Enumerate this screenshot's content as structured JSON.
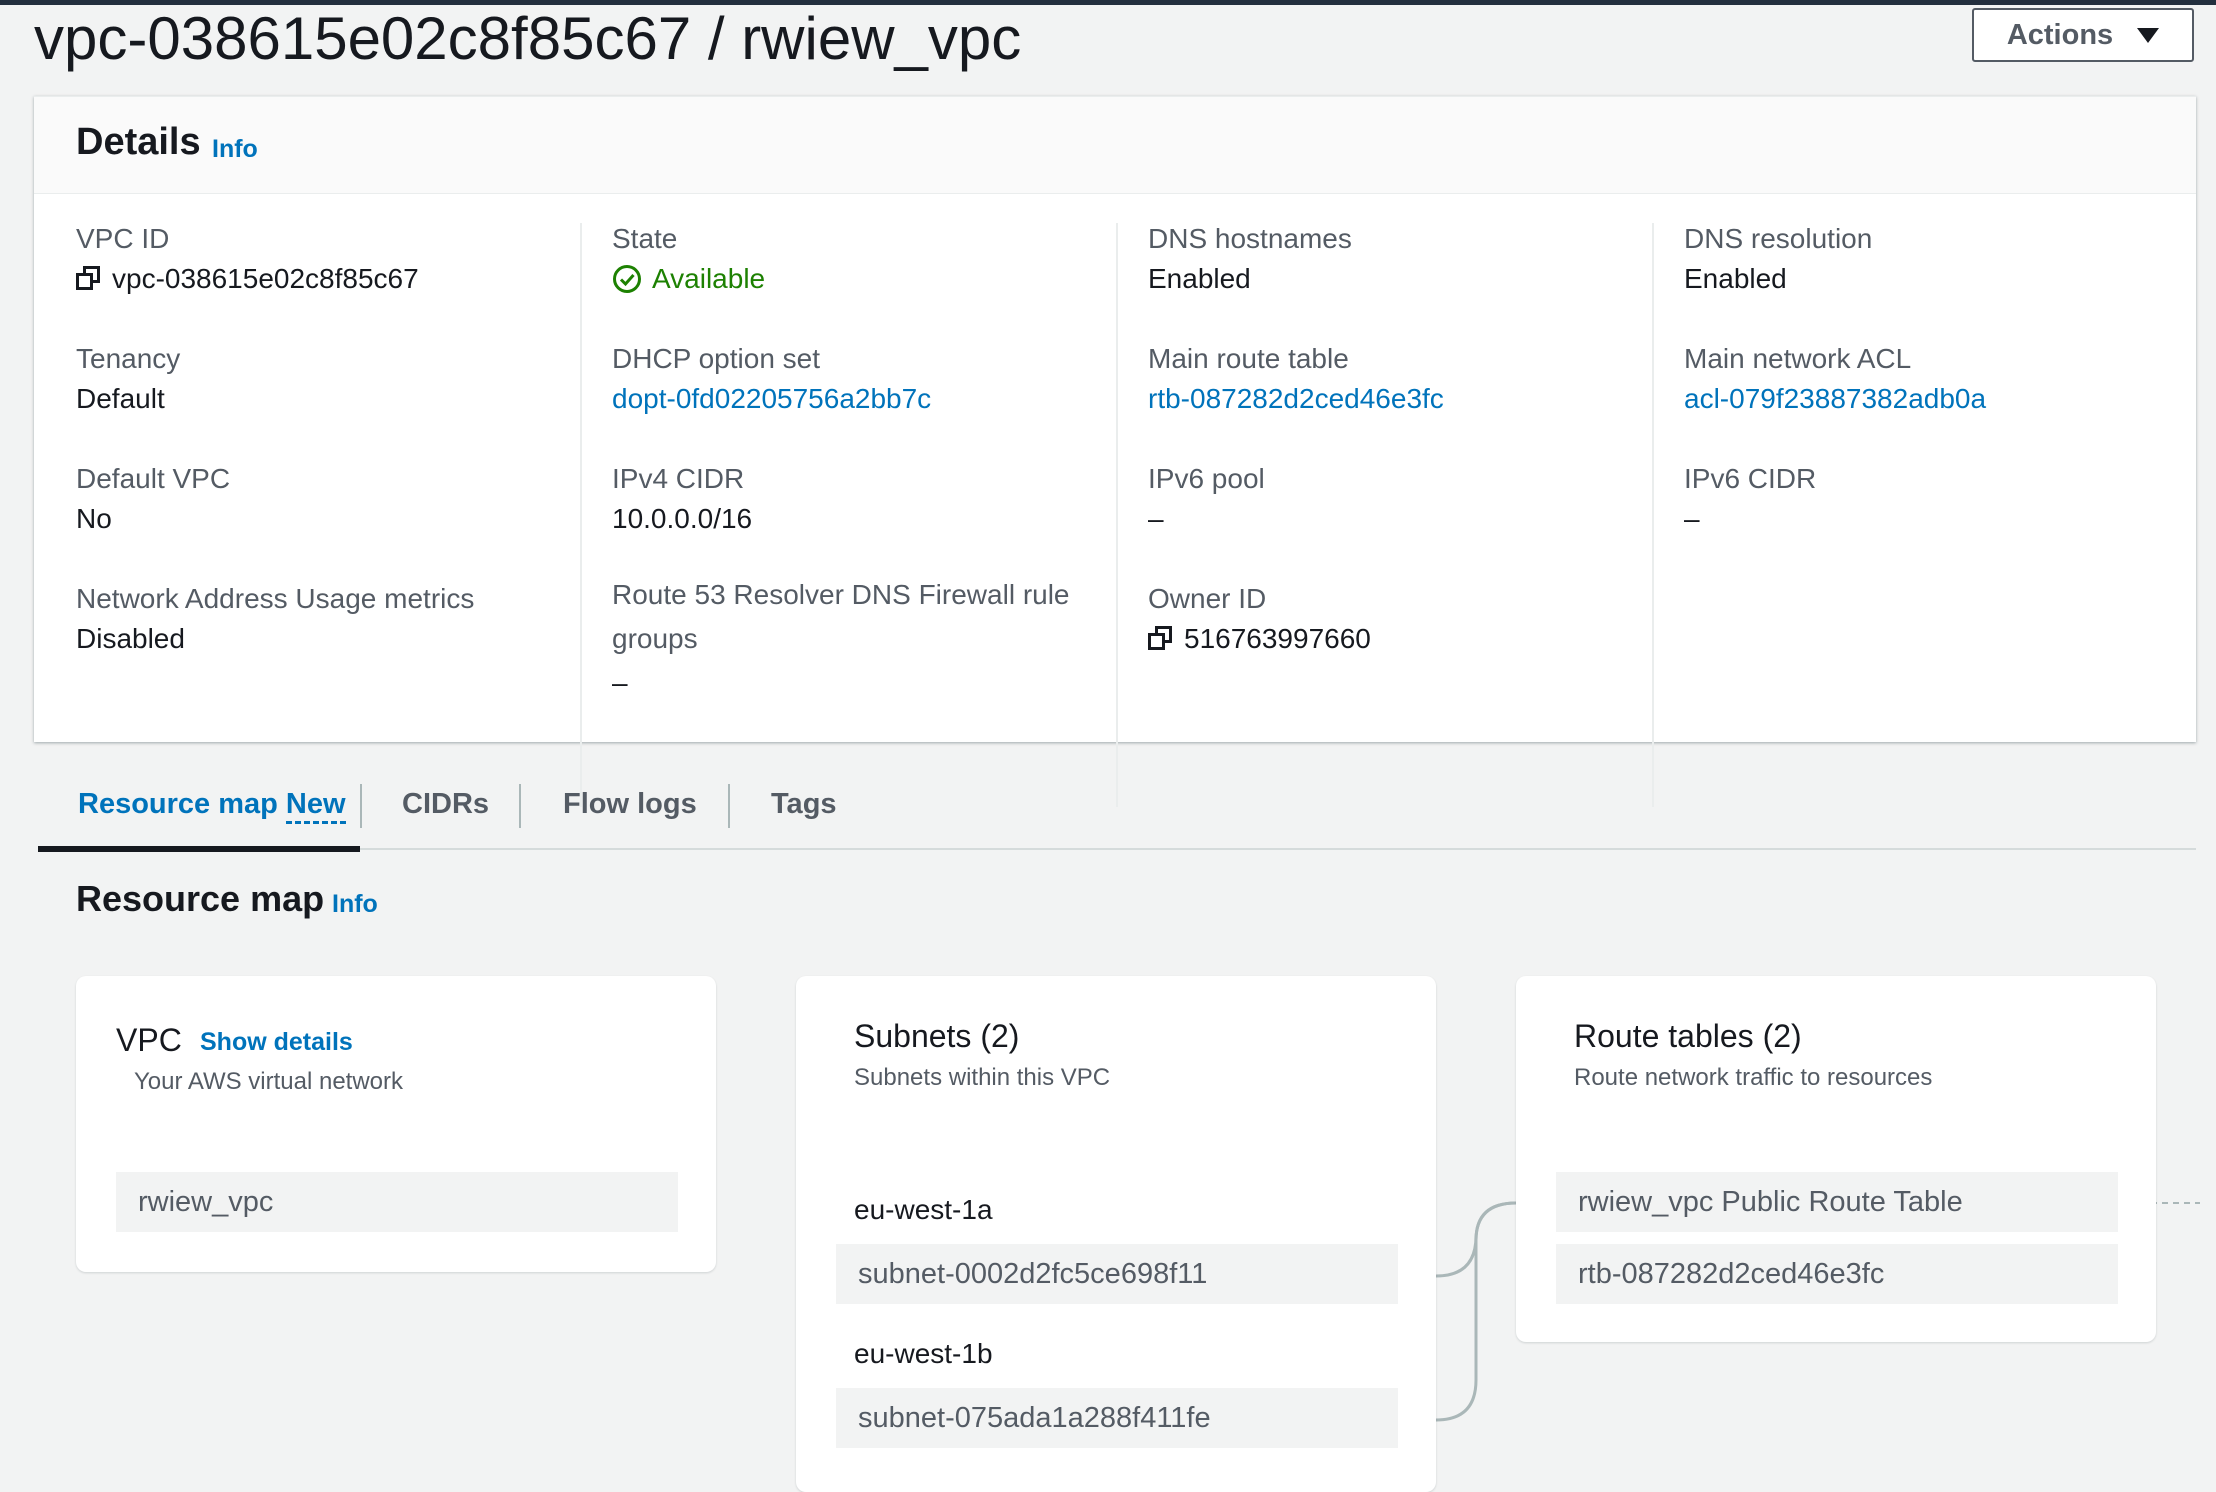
{
  "page": {
    "title": "vpc-038615e02c8f85c67 / rwiew_vpc",
    "actions_label": "Actions"
  },
  "details": {
    "title": "Details",
    "info": "Info",
    "columns": [
      [
        {
          "label": "VPC ID",
          "value": "vpc-038615e02c8f85c67",
          "copy": true
        },
        {
          "label": "Tenancy",
          "value": "Default"
        },
        {
          "label": "Default VPC",
          "value": "No"
        },
        {
          "label": "Network Address Usage metrics",
          "value": "Disabled"
        }
      ],
      [
        {
          "label": "State",
          "value": "Available",
          "status": "success"
        },
        {
          "label": "DHCP option set",
          "value": "dopt-0fd02205756a2bb7c",
          "link": true
        },
        {
          "label": "IPv4 CIDR",
          "value": "10.0.0.0/16"
        },
        {
          "label": "Route 53 Resolver DNS Firewall rule groups",
          "value": "–"
        }
      ],
      [
        {
          "label": "DNS hostnames",
          "value": "Enabled"
        },
        {
          "label": "Main route table",
          "value": "rtb-087282d2ced46e3fc",
          "link": true
        },
        {
          "label": "IPv6 pool",
          "value": "–"
        },
        {
          "label": "Owner ID",
          "value": "516763997660",
          "copy": true
        }
      ],
      [
        {
          "label": "DNS resolution",
          "value": "Enabled"
        },
        {
          "label": "Main network ACL",
          "value": "acl-079f23887382adb0a",
          "link": true
        },
        {
          "label": "IPv6 CIDR",
          "value": "–"
        }
      ]
    ]
  },
  "tabs": [
    {
      "label": "Resource map",
      "badge": "New",
      "active": true
    },
    {
      "label": "CIDRs"
    },
    {
      "label": "Flow logs"
    },
    {
      "label": "Tags"
    }
  ],
  "resource_map": {
    "title": "Resource map",
    "info": "Info",
    "vpc_card": {
      "title": "VPC",
      "show_details": "Show details",
      "subtitle": "Your AWS virtual network",
      "item": "rwiew_vpc"
    },
    "subnets_card": {
      "title": "Subnets (2)",
      "subtitle": "Subnets within this VPC",
      "groups": [
        {
          "az": "eu-west-1a",
          "subnet": "subnet-0002d2fc5ce698f11"
        },
        {
          "az": "eu-west-1b",
          "subnet": "subnet-075ada1a288f411fe"
        }
      ]
    },
    "route_tables_card": {
      "title": "Route tables (2)",
      "subtitle": "Route network traffic to resources",
      "items": [
        "rwiew_vpc Public Route Table",
        "rtb-087282d2ced46e3fc"
      ]
    }
  },
  "colors": {
    "link": "#0073bb",
    "success": "#1d8102",
    "text": "#16191f",
    "muted": "#545b64"
  }
}
